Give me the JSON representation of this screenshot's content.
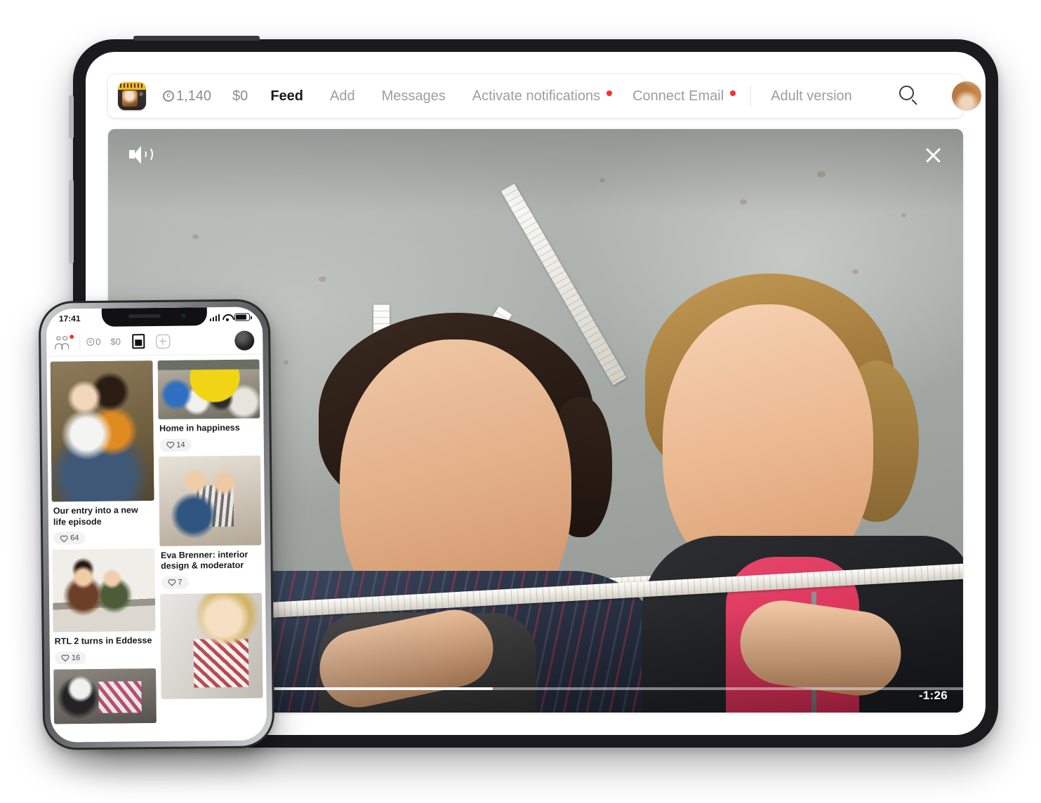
{
  "tablet": {
    "nav": {
      "logo_name": "app-logo",
      "coins": {
        "value": "1,140",
        "icon": "coin-icon"
      },
      "money": {
        "value": "$0"
      },
      "links": [
        {
          "label": "Feed",
          "active": true,
          "dot": false
        },
        {
          "label": "Add",
          "active": false,
          "dot": false
        },
        {
          "label": "Messages",
          "active": false,
          "dot": false
        },
        {
          "label": "Activate notifications",
          "active": false,
          "dot": true
        },
        {
          "label": "Connect Email",
          "active": false,
          "dot": true
        }
      ],
      "adult_version": "Adult version",
      "search_icon": "search-icon",
      "avatar": "user-avatar"
    },
    "player": {
      "volume_icon": "volume-on-icon",
      "close_icon": "close-icon",
      "time_remaining": "-1:26",
      "progress_percent": 45
    }
  },
  "phone": {
    "status": {
      "time": "17:41",
      "signal_icon": "cellular-signal-icon",
      "wifi_icon": "wifi-icon",
      "battery_icon": "battery-icon"
    },
    "toolbar": {
      "friends_icon": "friends-icon",
      "coins": {
        "value": "0",
        "icon": "coin-icon"
      },
      "money": "$0",
      "wallet_icon": "card-icon",
      "add_icon": "plus-icon",
      "avatar": "user-avatar"
    },
    "feed": {
      "left": [
        {
          "title": "Our entry into a new life episode",
          "likes": "64",
          "photo": "ph1"
        },
        {
          "title": "RTL 2 turns in Eddesse",
          "likes": "16",
          "photo": "ph4"
        },
        {
          "title": "",
          "likes": "",
          "photo": "ph6"
        }
      ],
      "right": [
        {
          "title": "Home in happiness",
          "likes": "14",
          "photo": "ph2"
        },
        {
          "title": "Eva Brenner: interior design & moderator",
          "likes": "7",
          "photo": "ph3"
        },
        {
          "title": "",
          "likes": "",
          "photo": "ph5"
        }
      ]
    }
  },
  "colors": {
    "accent_red": "#fa2f2f",
    "text_dark": "#17181a",
    "text_muted": "#9b9ea3",
    "logo_yellow": "#f3b91d"
  }
}
